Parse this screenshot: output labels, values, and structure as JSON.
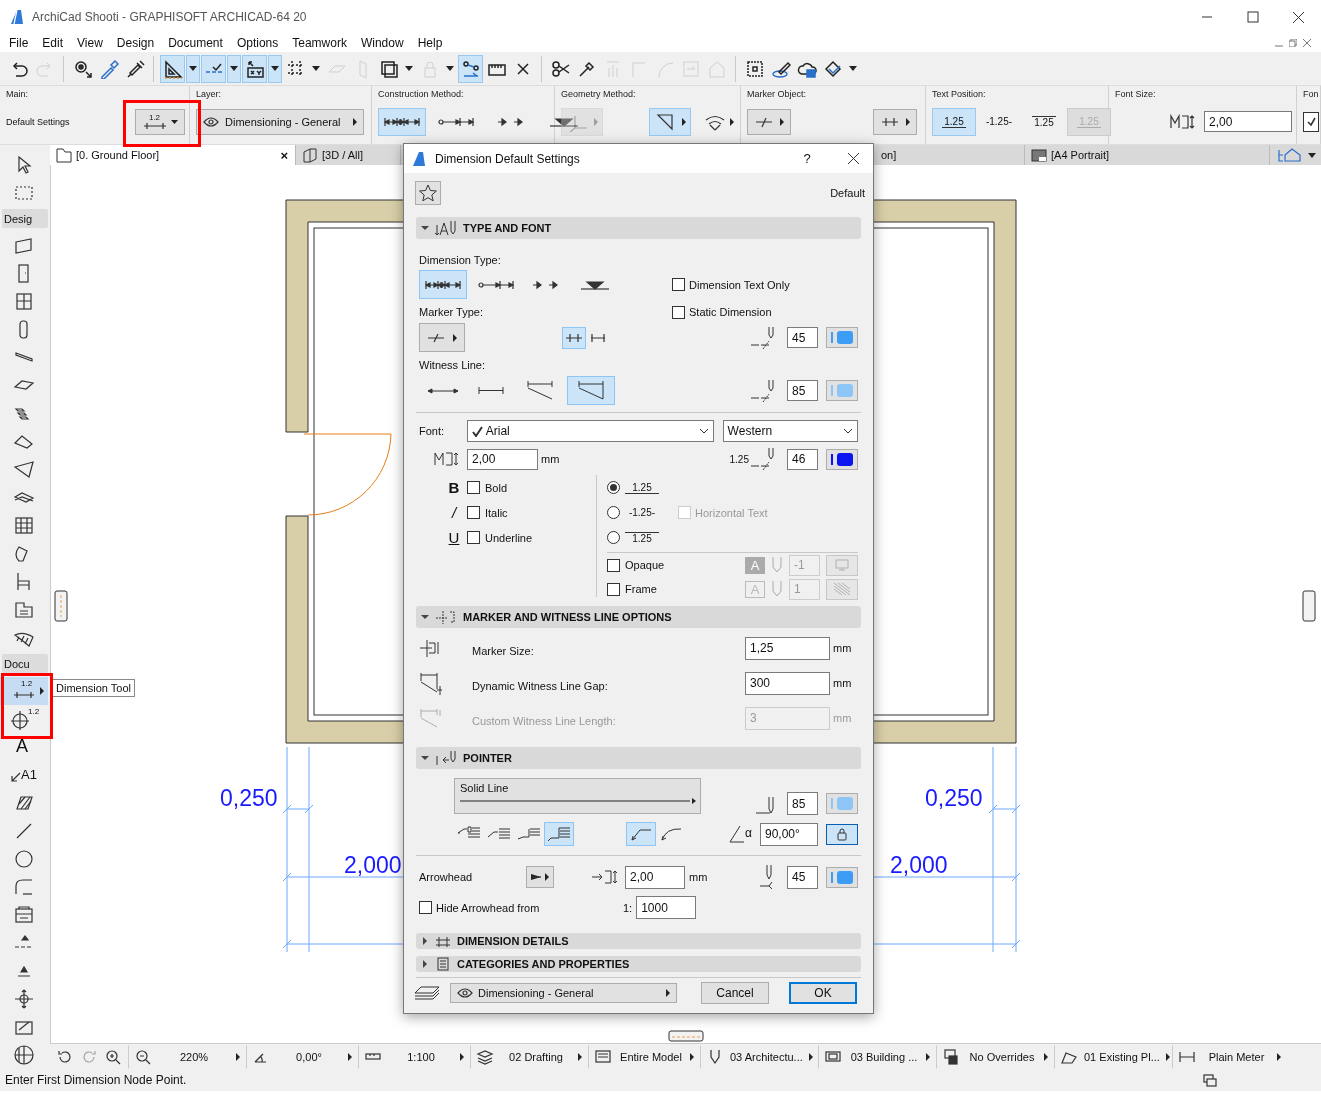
{
  "window": {
    "title": "ArchiCad Shooti - GRAPHISOFT ARCHICAD-64 20"
  },
  "menu": [
    "File",
    "Edit",
    "View",
    "Design",
    "Document",
    "Options",
    "Teamwork",
    "Window",
    "Help"
  ],
  "toolbar": [
    {
      "kind": "button",
      "selected": false,
      "disabled": false
    },
    {
      "kind": "button",
      "selected": false,
      "disabled": true
    },
    {
      "kind": "separator"
    },
    {
      "kind": "button",
      "selected": false,
      "disabled": false
    },
    {
      "kind": "button",
      "selected": false,
      "disabled": false
    },
    {
      "kind": "button",
      "selected": false,
      "disabled": false
    },
    {
      "kind": "separator"
    },
    {
      "kind": "button",
      "selected": true,
      "disabled": false
    },
    {
      "kind": "menu",
      "selected": true
    },
    {
      "kind": "button",
      "selected": true,
      "disabled": false
    },
    {
      "kind": "menu",
      "selected": true
    },
    {
      "kind": "button",
      "selected": true,
      "disabled": false
    },
    {
      "kind": "menu",
      "selected": true
    },
    {
      "kind": "button",
      "selected": false,
      "disabled": false
    },
    {
      "kind": "menu",
      "selected": false
    },
    {
      "kind": "button",
      "selected": false,
      "disabled": true
    },
    {
      "kind": "button",
      "selected": false,
      "disabled": true
    },
    {
      "kind": "button",
      "selected": false,
      "disabled": false
    },
    {
      "kind": "menu",
      "selected": false
    },
    {
      "kind": "button",
      "selected": false,
      "disabled": true
    },
    {
      "kind": "menu",
      "selected": false
    },
    {
      "kind": "button",
      "selected": true,
      "disabled": false
    },
    {
      "kind": "button",
      "selected": false,
      "disabled": false
    },
    {
      "kind": "button",
      "selected": false,
      "disabled": false
    },
    {
      "kind": "separator"
    },
    {
      "kind": "button",
      "selected": false,
      "disabled": false
    },
    {
      "kind": "button",
      "selected": false,
      "disabled": false
    },
    {
      "kind": "button",
      "selected": false,
      "disabled": true
    },
    {
      "kind": "button",
      "selected": false,
      "disabled": true
    },
    {
      "kind": "button",
      "selected": false,
      "disabled": true
    },
    {
      "kind": "button",
      "selected": false,
      "disabled": true
    },
    {
      "kind": "button",
      "selected": false,
      "disabled": true
    },
    {
      "kind": "separator"
    },
    {
      "kind": "button",
      "selected": false,
      "disabled": false
    },
    {
      "kind": "button",
      "selected": false,
      "disabled": false
    },
    {
      "kind": "button",
      "selected": false,
      "disabled": false
    },
    {
      "kind": "button",
      "selected": false,
      "disabled": false
    },
    {
      "kind": "menu",
      "selected": false
    }
  ],
  "info_box": [
    {
      "kind": "main",
      "label": "Main:",
      "value": "Default Settings",
      "icon_label": "1.2"
    },
    {
      "kind": "layer",
      "label": "Layer:",
      "value": "Dimensioning - General"
    },
    {
      "kind": "construction",
      "label": "Construction Method:",
      "options": [
        {
          "selected": true
        },
        {
          "selected": false
        },
        {
          "selected": false
        },
        {
          "selected": false
        }
      ]
    },
    {
      "kind": "geometry",
      "label": "Geometry Method:",
      "options": [
        {
          "selected": false,
          "disabled": true
        },
        {
          "selected": true,
          "disabled": false
        },
        {
          "selected": false,
          "disabled": false
        }
      ]
    },
    {
      "kind": "marker",
      "label": "Marker Object:"
    },
    {
      "kind": "text_position",
      "label": "Text Position:",
      "options": [
        {
          "text": "1.25",
          "selected": true,
          "disabled": false
        },
        {
          "text": "-1.25-",
          "selected": false,
          "disabled": false
        },
        {
          "text": "1.25",
          "selected": false,
          "disabled": false
        },
        {
          "text": "1.25",
          "selected": false,
          "disabled": true
        }
      ]
    },
    {
      "kind": "font_size",
      "label": "Font Size:",
      "value": "2,00"
    },
    {
      "kind": "font",
      "label": "Fon",
      "checked": true
    }
  ],
  "tabs": [
    {
      "label": "[0. Ground Floor]",
      "selected": true,
      "close": "×",
      "kind": "plan"
    },
    {
      "label": "[3D / All]",
      "selected": false,
      "kind": "model"
    },
    {
      "label": "on]",
      "selected": false,
      "kind": "section"
    },
    {
      "label": "[A4 Portrait]",
      "selected": false,
      "kind": "layout"
    }
  ],
  "toolbox": [
    {
      "kind": "tool",
      "selected": false
    },
    {
      "kind": "tool",
      "selected": false
    },
    {
      "kind": "header",
      "label": "Desig"
    },
    {
      "kind": "tool",
      "selected": false
    },
    {
      "kind": "tool",
      "selected": false
    },
    {
      "kind": "tool",
      "selected": false
    },
    {
      "kind": "tool",
      "selected": false
    },
    {
      "kind": "tool",
      "selected": false
    },
    {
      "kind": "tool",
      "selected": false
    },
    {
      "kind": "tool",
      "selected": false
    },
    {
      "kind": "tool",
      "selected": false
    },
    {
      "kind": "tool",
      "selected": false
    },
    {
      "kind": "tool",
      "selected": false
    },
    {
      "kind": "tool",
      "selected": false
    },
    {
      "kind": "tool",
      "selected": false
    },
    {
      "kind": "tool",
      "selected": false
    },
    {
      "kind": "tool",
      "selected": false
    },
    {
      "kind": "tool",
      "selected": false
    },
    {
      "kind": "header",
      "label": "Docu"
    },
    {
      "kind": "tool",
      "selected": true,
      "icon_label": "1.2",
      "tooltip": "Dimension Tool"
    },
    {
      "kind": "tool",
      "selected": false,
      "icon_label": "1.2"
    },
    {
      "kind": "tool",
      "selected": false,
      "icon_label": "A"
    },
    {
      "kind": "tool",
      "selected": false,
      "icon_label": "A1"
    },
    {
      "kind": "tool",
      "selected": false
    },
    {
      "kind": "tool",
      "selected": false
    },
    {
      "kind": "tool",
      "selected": false
    },
    {
      "kind": "tool",
      "selected": false
    },
    {
      "kind": "tool",
      "selected": false
    },
    {
      "kind": "tool",
      "selected": false
    },
    {
      "kind": "tool",
      "selected": false
    },
    {
      "kind": "tool",
      "selected": false
    },
    {
      "kind": "tool",
      "selected": false
    },
    {
      "kind": "tool",
      "selected": false
    }
  ],
  "canvas": {
    "dimension_labels": [
      "0,250",
      "0,250",
      "2,000",
      "2,000"
    ]
  },
  "quick_options": [
    {
      "value": "220%"
    },
    {
      "value": "0,00°"
    },
    {
      "value": "1:100"
    },
    {
      "value": "02 Drafting"
    },
    {
      "value": "Entire Model"
    },
    {
      "value": "03 Architectu..."
    },
    {
      "value": "03 Building ..."
    },
    {
      "value": "No Overrides"
    },
    {
      "value": "01 Existing Pl..."
    },
    {
      "value": "Plain Meter"
    }
  ],
  "status_bar": "Enter First Dimension Node Point.",
  "dialog": {
    "title": "Dimension Default Settings",
    "help": "?",
    "favorites_label": "Default",
    "type_and_font": {
      "title": "TYPE AND FONT",
      "expanded": true,
      "dimension_type_label": "Dimension Type:",
      "dimension_types": [
        {
          "selected": true
        },
        {
          "selected": false
        },
        {
          "selected": false
        },
        {
          "selected": false
        }
      ],
      "dimension_text_only": {
        "label": "Dimension Text Only",
        "checked": false
      },
      "marker_type_label": "Marker Type:",
      "static_dimension": {
        "label": "Static Dimension",
        "checked": false
      },
      "marker_styles": [
        {
          "selected": true
        },
        {
          "selected": false
        }
      ],
      "marker_pen": {
        "value": "45",
        "color": "#3d9cf5"
      },
      "witness_line_label": "Witness Line:",
      "witness_lines": [
        {
          "selected": false
        },
        {
          "selected": false
        },
        {
          "selected": false
        },
        {
          "selected": true
        }
      ],
      "witness_pen": {
        "value": "85",
        "color": "#8ec5f7"
      },
      "font_label": "Font:",
      "font": "Arial",
      "script": "Western",
      "font_size": "2,00",
      "font_size_unit": "mm",
      "text_pen": {
        "sample": "1.25",
        "value": "46",
        "color": "#0a14f0"
      },
      "styles": [
        {
          "glyph": "B",
          "label": "Bold",
          "checked": false,
          "kind": "bold"
        },
        {
          "glyph": "/",
          "label": "Italic",
          "checked": false,
          "kind": "italic"
        },
        {
          "glyph": "U",
          "label": "Underline",
          "checked": false,
          "kind": "underline"
        }
      ],
      "text_positions": [
        {
          "text": "1.25",
          "selected": true,
          "kind": "above"
        },
        {
          "text": "-1.25-",
          "selected": false,
          "kind": "inline"
        },
        {
          "text": "1.25",
          "selected": false,
          "kind": "below"
        }
      ],
      "horizontal_text": {
        "label": "Horizontal Text",
        "checked": false,
        "disabled": true
      },
      "opaque": {
        "label": "Opaque",
        "checked": false,
        "glyph": "A",
        "pen": "-1"
      },
      "frame": {
        "label": "Frame",
        "checked": false,
        "glyph": "A",
        "pen": "1"
      }
    },
    "marker_witness": {
      "title": "MARKER AND WITNESS LINE OPTIONS",
      "expanded": true,
      "rows": [
        {
          "label": "Marker Size:",
          "value": "1,25",
          "unit": "mm",
          "disabled": false
        },
        {
          "label": "Dynamic Witness Line Gap:",
          "value": "300",
          "unit": "mm",
          "disabled": false
        },
        {
          "label": "Custom Witness Line Length:",
          "value": "3",
          "unit": "mm",
          "disabled": true
        }
      ]
    },
    "pointer": {
      "title": "POINTER",
      "expanded": true,
      "line_type": "Solid Line",
      "line_pen": {
        "value": "85",
        "color": "#8ec5f7"
      },
      "pointer_shapes": [
        {
          "selected": false
        },
        {
          "selected": false
        },
        {
          "selected": false
        },
        {
          "selected": true
        }
      ],
      "curve_types": [
        {
          "selected": true
        },
        {
          "selected": false
        }
      ],
      "angle_glyph": "α",
      "angle": "90,00°",
      "angle_locked": true,
      "arrowhead_label": "Arrowhead",
      "arrowhead_size": "2,00",
      "arrowhead_unit": "mm",
      "arrowhead_pen": {
        "value": "45",
        "color": "#3d9cf5"
      },
      "hide_arrowhead": {
        "label": "Hide Arrowhead from",
        "checked": false
      },
      "scale_prefix": "1:",
      "scale": "1000"
    },
    "collapsed_sections": [
      {
        "title": "DIMENSION DETAILS",
        "expanded": false
      },
      {
        "title": "CATEGORIES AND PROPERTIES",
        "expanded": false
      }
    ],
    "layer": "Dimensioning - General",
    "buttons": [
      {
        "label": "Cancel",
        "default": false
      },
      {
        "label": "OK",
        "default": true
      }
    ]
  }
}
